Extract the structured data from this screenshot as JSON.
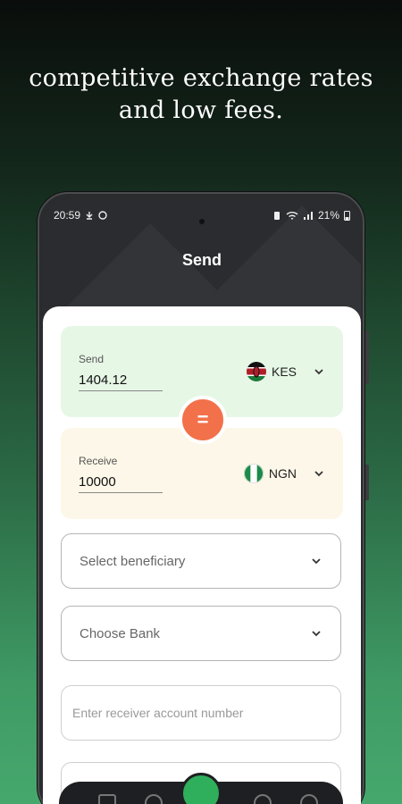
{
  "headline": {
    "line1": "competitive exchange rates",
    "line2": "and low fees."
  },
  "status_bar": {
    "time": "20:59",
    "battery": "21%"
  },
  "app": {
    "title": "Send"
  },
  "send_card": {
    "label": "Send",
    "amount": "1404.12",
    "currency": "KES",
    "flag_icon": "kenya-flag-icon"
  },
  "swap_button": {
    "symbol": "="
  },
  "receive_card": {
    "label": "Receive",
    "amount": "10000",
    "currency": "NGN",
    "flag_icon": "nigeria-flag-icon"
  },
  "form": {
    "beneficiary_placeholder": "Select beneficiary",
    "bank_placeholder": "Choose Bank",
    "account_placeholder": "Enter receiver account number"
  },
  "colors": {
    "accent_orange": "#f2714a",
    "send_card_bg": "#e6f7e6",
    "receive_card_bg": "#fcf7e8",
    "nav_accent": "#2fae5c"
  }
}
